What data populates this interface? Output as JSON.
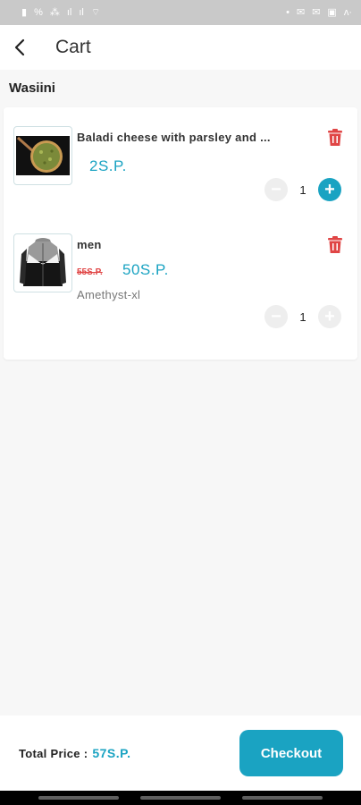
{
  "status_bar": {
    "left_glyphs": [
      "▮",
      "%",
      "⁂",
      "ıl",
      "ıl",
      "⌔"
    ],
    "right_glyphs": [
      "•",
      "✉",
      "✉",
      "▣",
      "ʌ·"
    ]
  },
  "header": {
    "title": "Cart",
    "back_icon": "back-arrow-icon"
  },
  "store": {
    "name": "Wasiini"
  },
  "cart_items": [
    {
      "name": "Baladi cheese with parsley and ...",
      "price": "2S.P.",
      "old_price": "",
      "variant": "",
      "quantity": "1",
      "image_icon": "pizza-image"
    },
    {
      "name": "men",
      "price": "50S.P.",
      "old_price": "55S.P.",
      "variant": "Amethyst-xl",
      "quantity": "1",
      "image_icon": "jacket-image"
    }
  ],
  "footer": {
    "total_label": "Total Price :",
    "total_value": "57S.P.",
    "checkout_label": "Checkout"
  },
  "colors": {
    "accent": "#1aa3c2",
    "danger": "#e04545",
    "background": "#f7f7f7"
  }
}
